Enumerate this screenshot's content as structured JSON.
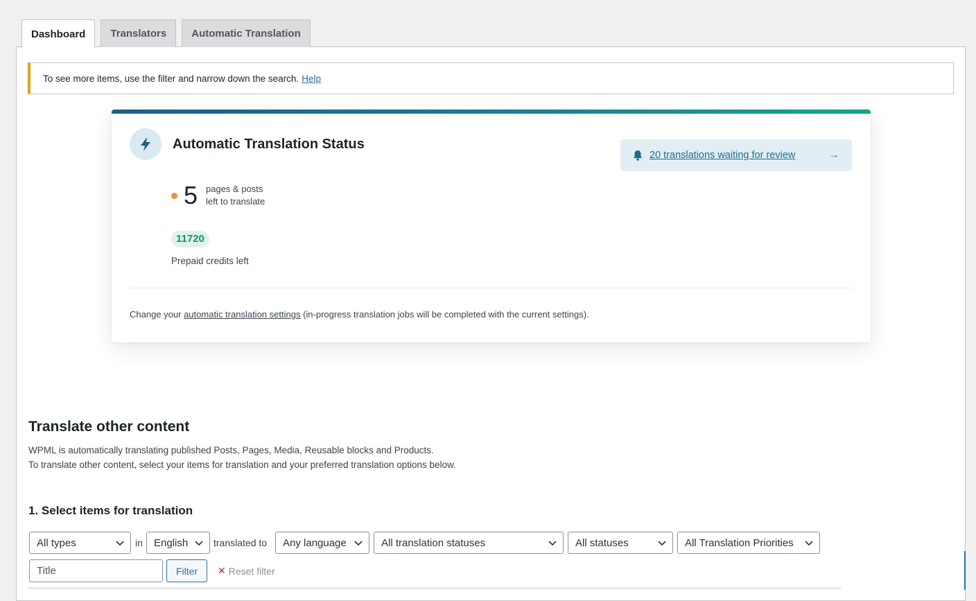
{
  "tabs": [
    {
      "label": "Dashboard",
      "active": true
    },
    {
      "label": "Translators",
      "active": false
    },
    {
      "label": "Automatic Translation",
      "active": false
    }
  ],
  "notice": {
    "text": "To see more items, use the filter and narrow down the search.",
    "link": "Help"
  },
  "status_card": {
    "title": "Automatic Translation Status",
    "review_link": "20 translations waiting for review",
    "pages_left_count": "5",
    "pages_left_line1": "pages & posts",
    "pages_left_line2": "left to translate",
    "credits_value": "11720",
    "credits_label": "Prepaid credits left",
    "footer_prefix": "Change your",
    "footer_link": "automatic translation settings",
    "footer_suffix": "(in-progress translation jobs will be completed with the current settings).",
    "colors": {
      "accent_orange": "#f0913a",
      "credits_green": "#17936f",
      "link_blue": "#1a6e8e"
    }
  },
  "other_content": {
    "title": "Translate other content",
    "desc1": "WPML is automatically translating published Posts, Pages, Media, Reusable blocks and Products.",
    "desc2": "To translate other content, select your items for translation and your preferred translation options below."
  },
  "select_items": {
    "title": "1. Select items for translation",
    "type_select": "All types",
    "in_label": "in",
    "language_select": "English",
    "translated_to_label": "translated to",
    "target_select": "Any language",
    "translation_status_select": "All translation statuses",
    "status_select": "All statuses",
    "priority_select": "All Translation Priorities",
    "title_placeholder": "Title",
    "filter_button": "Filter",
    "reset_filter": "Reset filter"
  }
}
